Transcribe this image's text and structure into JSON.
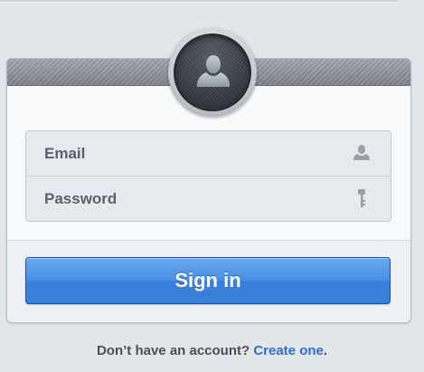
{
  "form": {
    "email_placeholder": "Email",
    "password_placeholder": "Password",
    "signin_label": "Sign in"
  },
  "footer": {
    "prompt": "Don’t have an account?",
    "link": "Create one",
    "period": "."
  },
  "icons": {
    "avatar": "user-silhouette-icon",
    "email_field": "user-icon",
    "password_field": "key-icon"
  },
  "colors": {
    "background": "#e2e5ea",
    "button": "#3f84de",
    "link": "#2f6fcc",
    "header": "#8d939c"
  }
}
